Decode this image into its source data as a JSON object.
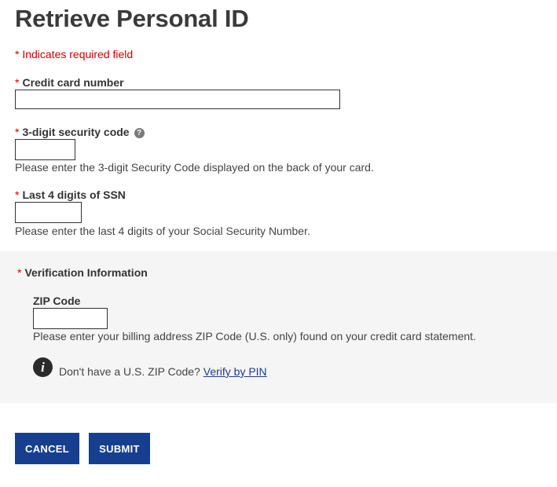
{
  "page": {
    "title": "Retrieve Personal ID",
    "required_note": "* Indicates required field"
  },
  "fields": {
    "credit_card": {
      "star": "*",
      "label": "Credit card number",
      "value": ""
    },
    "security_code": {
      "star": "*",
      "label": "3-digit security code",
      "help_icon": "?",
      "value": "",
      "help": "Please enter the 3-digit Security Code displayed on the back of your card."
    },
    "ssn": {
      "star": "*",
      "label": "Last 4 digits of SSN",
      "value": "",
      "help": "Please enter the last 4 digits of your Social Security Number."
    }
  },
  "verification": {
    "star": "*",
    "title": "Verification Information",
    "zip_label": "ZIP Code",
    "zip_value": "",
    "zip_help": "Please enter your billing address ZIP Code (U.S. only) found on your credit card statement.",
    "info_icon": "i",
    "pin_prompt": "Don't have a U.S. ZIP Code?",
    "pin_link": "Verify by PIN"
  },
  "buttons": {
    "cancel": "CANCEL",
    "submit": "SUBMIT"
  },
  "colors": {
    "required": "#cc0000",
    "button": "#173f8f",
    "link": "#1a3d8f",
    "panel": "#f5f5f5"
  }
}
